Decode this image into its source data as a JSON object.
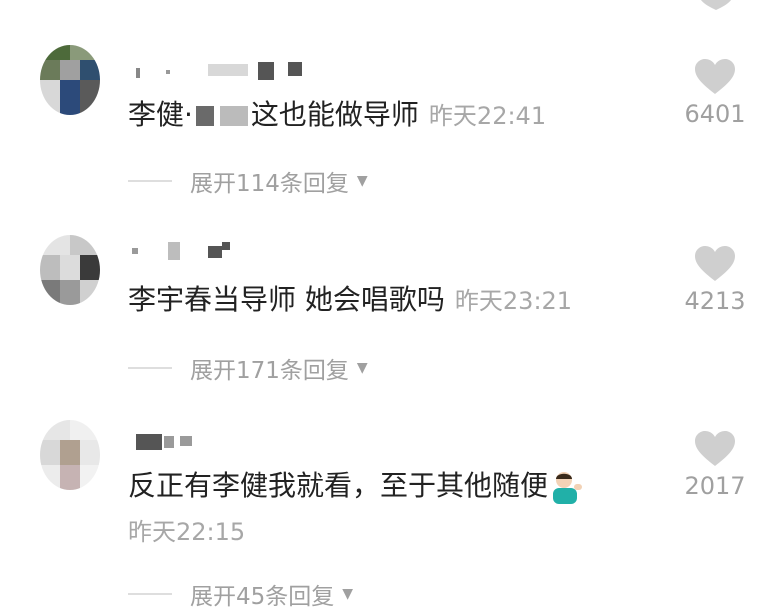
{
  "comments": [
    {
      "text_start": "李健·",
      "text_end": "这也能做导师",
      "time": "昨天22:41",
      "likes": "6401",
      "expand": "展开114条回复"
    },
    {
      "text": "李宇春当导师 她会唱歌吗",
      "time": "昨天23:21",
      "likes": "4213",
      "expand": "展开171条回复"
    },
    {
      "text": "反正有李健我就看，至于其他随便",
      "time": "昨天22:15",
      "likes": "2017",
      "expand": "展开45条回复"
    }
  ],
  "icons": {
    "like": "heart-icon",
    "expand_arrow": "triangle-down-icon",
    "emoji": "person-tipping-hand-emoji"
  },
  "colors": {
    "text": "#222222",
    "secondary": "#a7a7a7",
    "heart": "#cfcfcf"
  }
}
